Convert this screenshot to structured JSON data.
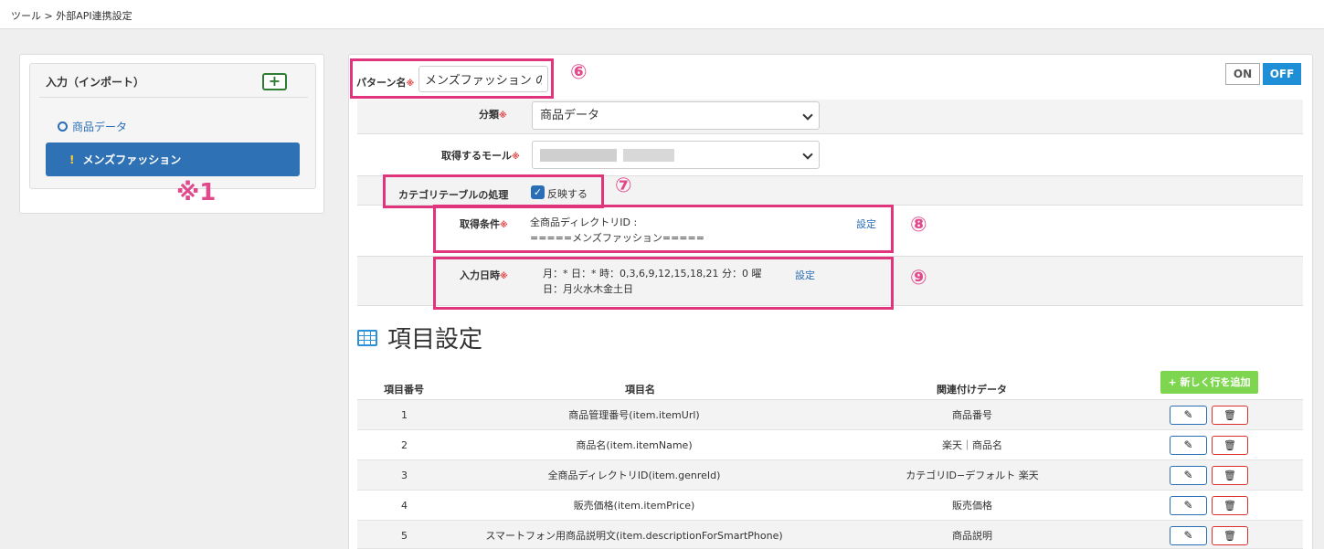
{
  "breadcrumb": "ツール > 外部API連携設定",
  "left": {
    "title": "入力（インポート）",
    "add_button": "+",
    "items": [
      {
        "label": "商品データ"
      },
      {
        "label": "メンズファッション",
        "marker": "!"
      }
    ],
    "note": "※1"
  },
  "toggle": {
    "on": "ON",
    "off": "OFF"
  },
  "pattern": {
    "label": "パターン名",
    "required": "※",
    "value": "メンズファッション の条",
    "annotation": "⑥"
  },
  "category": {
    "label": "分類",
    "required": "※",
    "value": "商品データ"
  },
  "mall": {
    "label": "取得するモール",
    "required": "※"
  },
  "category_table": {
    "label": "カテゴリテーブルの処理",
    "checkbox_label": "反映する",
    "checked": true,
    "annotation": "⑦"
  },
  "condition": {
    "label": "取得条件",
    "required": "※",
    "line1": "全商品ディレクトリID :",
    "line2": "=====メンズファッション=====",
    "link": "設定",
    "annotation": "⑧"
  },
  "input_date": {
    "label": "入力日時",
    "required": "※",
    "line1": "月：* 日：* 時：0,3,6,9,12,15,18,21 分：0 曜",
    "line2": "日：月火水木金土日",
    "link": "設定",
    "annotation": "⑨"
  },
  "section": {
    "title": "項目設定"
  },
  "table": {
    "add_row": "+ 新しく行を追加",
    "headers": {
      "num": "項目番号",
      "name": "項目名",
      "rel": "関連付けデータ"
    },
    "rows": [
      {
        "num": "1",
        "name": "商品管理番号(item.itemUrl)",
        "rel": "商品番号"
      },
      {
        "num": "2",
        "name": "商品名(item.itemName)",
        "rel": "楽天｜商品名"
      },
      {
        "num": "3",
        "name": "全商品ディレクトリID(item.genreId)",
        "rel": "カテゴリID−デフォルト 楽天"
      },
      {
        "num": "4",
        "name": "販売価格(item.itemPrice)",
        "rel": "販売価格"
      },
      {
        "num": "5",
        "name": "スマートフォン用商品説明文(item.descriptionForSmartPhone)",
        "rel": "商品説明"
      }
    ]
  }
}
